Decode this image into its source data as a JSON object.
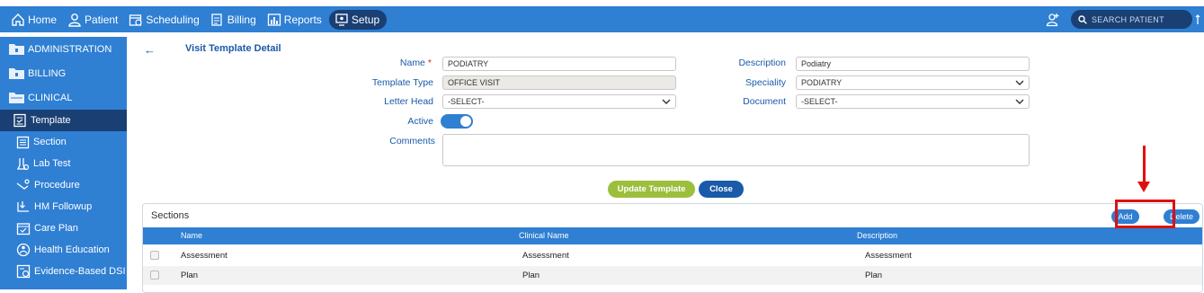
{
  "nav": {
    "items": [
      {
        "label": "Home",
        "icon": "home-icon"
      },
      {
        "label": "Patient",
        "icon": "user-icon"
      },
      {
        "label": "Scheduling",
        "icon": "calendar-icon"
      },
      {
        "label": "Billing",
        "icon": "billing-icon"
      },
      {
        "label": "Reports",
        "icon": "reports-icon"
      },
      {
        "label": "Setup",
        "icon": "setup-icon",
        "active": true
      }
    ],
    "search_placeholder": "SEARCH PATIENT"
  },
  "sidebar": {
    "groups": [
      {
        "label": "ADMINISTRATION",
        "icon": "folder-icon"
      },
      {
        "label": "BILLING",
        "icon": "folder-icon"
      },
      {
        "label": "CLINICAL",
        "icon": "folder-icon"
      }
    ],
    "items": [
      {
        "label": "Template",
        "icon": "template-icon",
        "active": true
      },
      {
        "label": "Section",
        "icon": "section-icon"
      },
      {
        "label": "Lab Test",
        "icon": "lab-test-icon"
      },
      {
        "label": "Procedure",
        "icon": "procedure-icon"
      },
      {
        "label": "HM Followup",
        "icon": "followup-icon"
      },
      {
        "label": "Care Plan",
        "icon": "care-plan-icon"
      },
      {
        "label": "Health Education",
        "icon": "health-education-icon"
      },
      {
        "label": "Evidence-Based DSI",
        "icon": "evidence-icon"
      }
    ]
  },
  "page": {
    "back": "←",
    "title": "Visit Template Detail"
  },
  "form": {
    "name_label": "Name",
    "name_value": "PODIATRY",
    "template_type_label": "Template Type",
    "template_type_value": "OFFICE VISIT",
    "letter_head_label": "Letter Head",
    "letter_head_value": "-SELECT-",
    "active_label": "Active",
    "comments_label": "Comments",
    "description_label": "Description",
    "description_value": "Podiatry",
    "speciality_label": "Speciality",
    "speciality_value": "PODIATRY",
    "document_label": "Document",
    "document_value": "-SELECT-",
    "required_marker": "*"
  },
  "buttons": {
    "update": "Update Template",
    "close": "Close"
  },
  "sections": {
    "title": "Sections",
    "add_label": "Add",
    "delete_label": "Delete",
    "columns": [
      "Name",
      "Clinical Name",
      "Description"
    ],
    "rows": [
      {
        "name": "Assessment",
        "clinical_name": "Assessment",
        "description": "Assessment"
      },
      {
        "name": "Plan",
        "clinical_name": "Plan",
        "description": "Plan"
      }
    ]
  },
  "colors": {
    "primary": "#2f7fd3",
    "dark": "#1a3f73",
    "accent_green": "#9bbf3c",
    "annotation_red": "#e01010"
  }
}
